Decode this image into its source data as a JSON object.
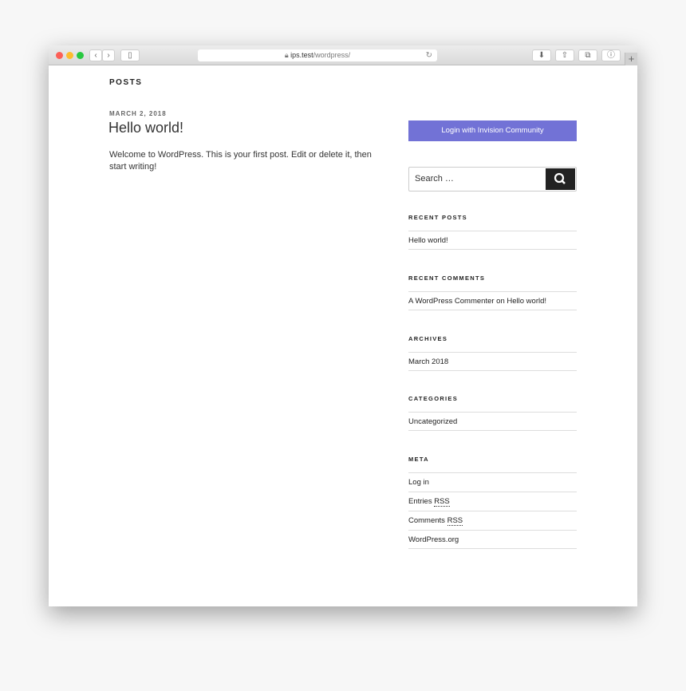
{
  "browser": {
    "url_host": "ips.test",
    "url_path": "/wordpress/",
    "icons": [
      "back-icon",
      "forward-icon",
      "sidebar-icon",
      "lock-icon",
      "reload-icon",
      "download-icon",
      "share-icon",
      "tabs-icon",
      "info-icon",
      "new-tab-icon"
    ]
  },
  "page": {
    "section": "POSTS",
    "post": {
      "date": "MARCH 2, 2018",
      "title": "Hello world!",
      "body": "Welcome to WordPress. This is your first post. Edit or delete it, then start writing!"
    }
  },
  "sidebar": {
    "login_label": "Login with Invision Community",
    "login_color": "#7272d6",
    "search_placeholder": "Search …",
    "recent_posts": {
      "title": "RECENT POSTS",
      "items": [
        "Hello world!"
      ]
    },
    "recent_comments": {
      "title": "RECENT COMMENTS",
      "author": "A WordPress Commenter",
      "on": "on",
      "post": "Hello world!"
    },
    "archives": {
      "title": "ARCHIVES",
      "items": [
        "March 2018"
      ]
    },
    "categories": {
      "title": "CATEGORIES",
      "items": [
        "Uncategorized"
      ]
    },
    "meta": {
      "title": "META",
      "login": "Log in",
      "entries": "Entries",
      "comments": "Comments",
      "rss": "RSS",
      "wporg": "WordPress.org"
    }
  }
}
